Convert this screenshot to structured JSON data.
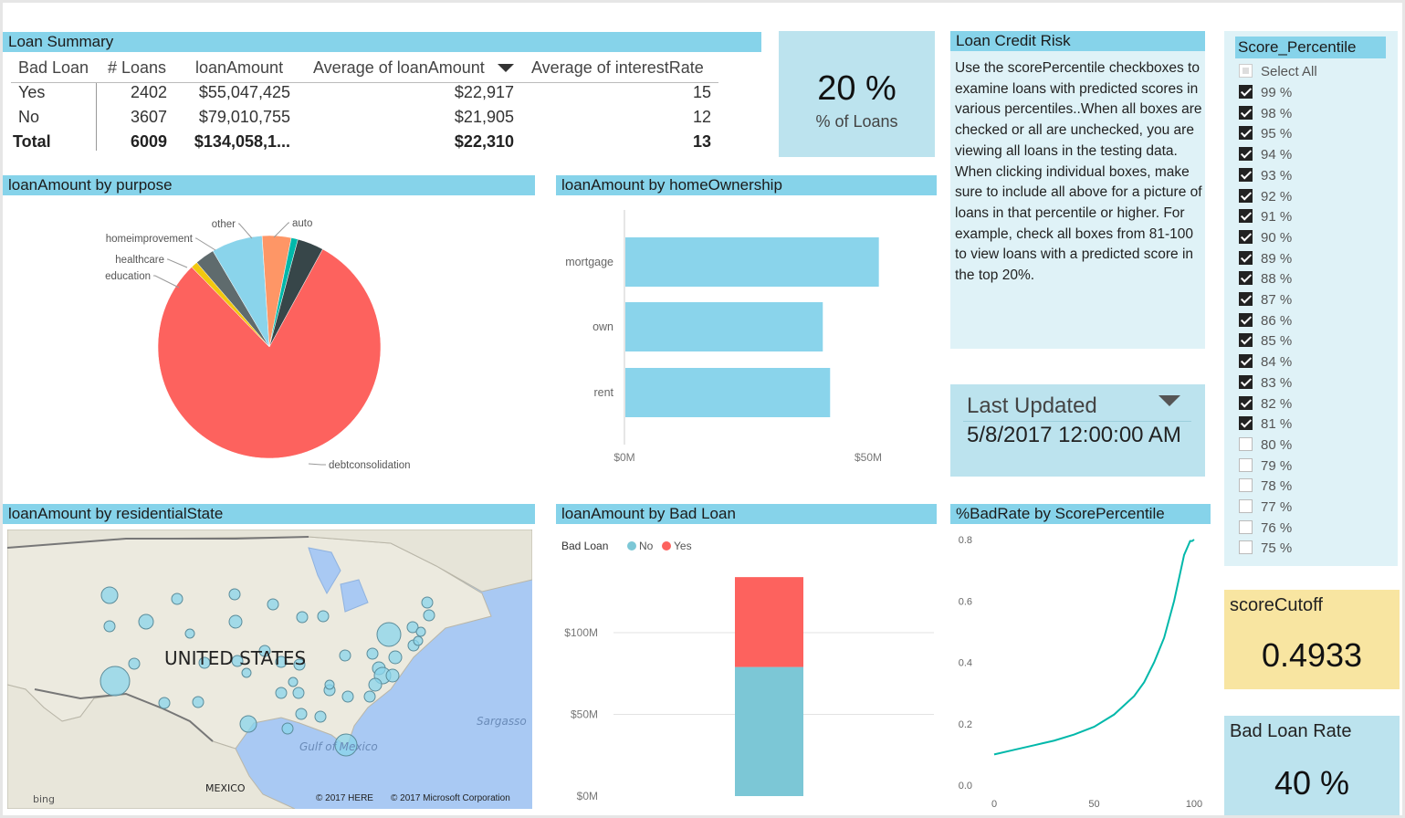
{
  "loan_summary": {
    "title": "Loan Summary",
    "columns": [
      "Bad Loan",
      "# Loans",
      "loanAmount",
      "Average of loanAmount",
      "Average of interestRate"
    ],
    "rows": [
      [
        "Yes",
        "2402",
        "$55,047,425",
        "$22,917",
        "15"
      ],
      [
        "No",
        "3607",
        "$79,010,755",
        "$21,905",
        "12"
      ],
      [
        "Total",
        "6009",
        "$134,058,1...",
        "$22,310",
        "13"
      ]
    ]
  },
  "pct_loans_card": {
    "value": "20 %",
    "label": "% of Loans"
  },
  "credit_risk": {
    "title": "Loan Credit Risk",
    "text": "Use the scorePercentile checkboxes to examine loans with predicted scores in various percentiles..When all boxes are checked or all are unchecked, you are viewing all loans in the testing data.  When clicking individual boxes, make sure to include all above for a picture of loans in that percentile or higher.  For example, check all boxes from 81-100 to view loans with a predicted score in the top 20%."
  },
  "last_updated": {
    "label": "Last Updated",
    "value": "5/8/2017 12:00:00 AM"
  },
  "score_percentile": {
    "title": "Score_Percentile",
    "select_all": "Select All",
    "items": [
      {
        "label": "99 %",
        "checked": true
      },
      {
        "label": "98 %",
        "checked": true
      },
      {
        "label": "95 %",
        "checked": true
      },
      {
        "label": "94 %",
        "checked": true
      },
      {
        "label": "93 %",
        "checked": true
      },
      {
        "label": "92 %",
        "checked": true
      },
      {
        "label": "91 %",
        "checked": true
      },
      {
        "label": "90 %",
        "checked": true
      },
      {
        "label": "89 %",
        "checked": true
      },
      {
        "label": "88 %",
        "checked": true
      },
      {
        "label": "87 %",
        "checked": true
      },
      {
        "label": "86 %",
        "checked": true
      },
      {
        "label": "85 %",
        "checked": true
      },
      {
        "label": "84 %",
        "checked": true
      },
      {
        "label": "83 %",
        "checked": true
      },
      {
        "label": "82 %",
        "checked": true
      },
      {
        "label": "81 %",
        "checked": true
      },
      {
        "label": "80 %",
        "checked": false
      },
      {
        "label": "79 %",
        "checked": false
      },
      {
        "label": "78 %",
        "checked": false
      },
      {
        "label": "77 %",
        "checked": false
      },
      {
        "label": "76 %",
        "checked": false
      },
      {
        "label": "75 %",
        "checked": false
      }
    ]
  },
  "score_cutoff": {
    "label": "scoreCutoff",
    "value": "0.4933",
    "color": "#f8e5a1"
  },
  "bad_loan_rate": {
    "label": "Bad Loan Rate",
    "value": "40 %"
  },
  "map": {
    "title": "loanAmount by residentialState",
    "labels": {
      "country": "UNITED STATES",
      "gulf": "Gulf of Mexico",
      "mexico": "MEXICO",
      "sargasso": "Sargasso"
    },
    "attribution_here": "© 2017 HERE",
    "attribution_ms": "© 2017 Microsoft Corporation",
    "bing": "bing"
  },
  "chart_data": [
    {
      "type": "pie",
      "title": "loanAmount by purpose",
      "slices": [
        {
          "label": "debtconsolidation",
          "value": 81.6,
          "color": "#fd625e"
        },
        {
          "label": "education",
          "value": 1.0,
          "color": "#f2c80f"
        },
        {
          "label": "healthcare",
          "value": 2.9,
          "color": "#5f6b6d"
        },
        {
          "label": "homeimprovement",
          "value": 7.6,
          "color": "#8ad4eb"
        },
        {
          "label": "other",
          "value": 4.3,
          "color": "#fe9666"
        },
        {
          "label": "",
          "value": 1.0,
          "color": "#01b8aa"
        },
        {
          "label": "auto",
          "value": 3.9,
          "color": "#374649"
        }
      ]
    },
    {
      "type": "bar",
      "orientation": "horizontal",
      "title": "loanAmount by homeOwnership",
      "categories": [
        "mortgage",
        "own",
        "rent"
      ],
      "values": [
        52,
        40.5,
        42
      ],
      "xlim": [
        0,
        50
      ],
      "xticks": [
        "$0M",
        "$50M"
      ],
      "color": "#8ad4eb"
    },
    {
      "type": "bar",
      "stacked": true,
      "title": "loanAmount by Bad Loan",
      "legend_title": "Bad Loan",
      "series": [
        {
          "name": "No",
          "values": [
            79.0
          ],
          "color": "#7cc7d6"
        },
        {
          "name": "Yes",
          "values": [
            55.0
          ],
          "color": "#fd625e"
        }
      ],
      "yticks": [
        "$0M",
        "$50M",
        "$100M"
      ],
      "ylim": [
        0,
        100
      ]
    },
    {
      "type": "line",
      "title": "%BadRate by ScorePercentile",
      "x": [
        0,
        10,
        20,
        30,
        40,
        50,
        60,
        70,
        75,
        80,
        85,
        90,
        93,
        95,
        97,
        98,
        99,
        100
      ],
      "y": [
        0.1,
        0.115,
        0.13,
        0.145,
        0.165,
        0.19,
        0.23,
        0.29,
        0.335,
        0.4,
        0.48,
        0.6,
        0.69,
        0.75,
        0.78,
        0.795,
        0.795,
        0.8
      ],
      "xticks": [
        "0",
        "50",
        "100"
      ],
      "yticks": [
        "0.0",
        "0.2",
        "0.4",
        "0.6",
        "0.8"
      ],
      "xlim": [
        0,
        100
      ],
      "ylim": [
        0,
        0.8
      ],
      "color": "#01b8aa"
    }
  ]
}
